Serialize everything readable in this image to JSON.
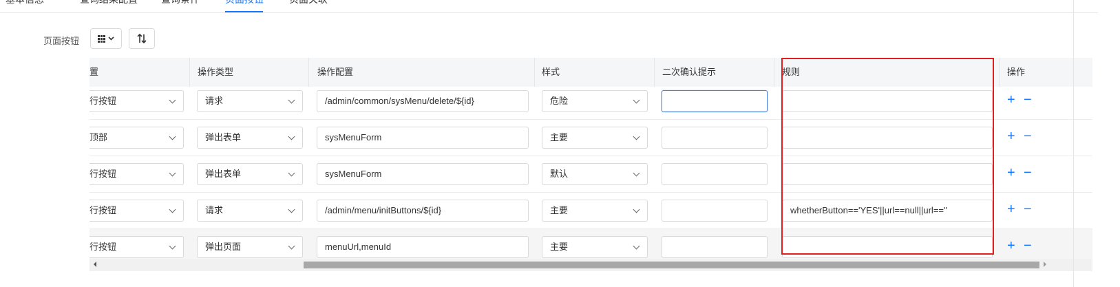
{
  "tabs": [
    {
      "label": "基本信息"
    },
    {
      "label": "查询结果配置"
    },
    {
      "label": "查询条件"
    },
    {
      "label": "页面按钮",
      "active": true
    },
    {
      "label": "页面关联"
    }
  ],
  "toolbar": {
    "label": "页面按钮",
    "grid_icon": "grid-icon",
    "sort_icon": "sort-icon"
  },
  "table": {
    "headers": {
      "position": "置",
      "op_type": "操作类型",
      "op_config": "操作配置",
      "style": "样式",
      "confirm": "二次确认提示",
      "rule": "规则",
      "action": "操作"
    },
    "rows": [
      {
        "position": "行按钮",
        "op_type": "请求",
        "op_config": "/admin/common/sysMenu/delete/${id}",
        "style": "危险",
        "confirm": "",
        "rule": ""
      },
      {
        "position": "顶部",
        "op_type": "弹出表单",
        "op_config": "sysMenuForm",
        "style": "主要",
        "confirm": "",
        "rule": ""
      },
      {
        "position": "行按钮",
        "op_type": "弹出表单",
        "op_config": "sysMenuForm",
        "style": "默认",
        "confirm": "",
        "rule": ""
      },
      {
        "position": "行按钮",
        "op_type": "请求",
        "op_config": "/admin/menu/initButtons/${id}",
        "style": "主要",
        "confirm": "",
        "rule": "whetherButton=='YES'||url==null||url==''"
      },
      {
        "position": "行按钮",
        "op_type": "弹出页面",
        "op_config": "menuUrl,menuId",
        "style": "主要",
        "confirm": "",
        "rule": ""
      }
    ],
    "add_symbol": "+",
    "remove_symbol": "−"
  },
  "colors": {
    "accent": "#1677ff",
    "highlight_box": "#e02020",
    "header_bg": "#f5f6f7"
  }
}
